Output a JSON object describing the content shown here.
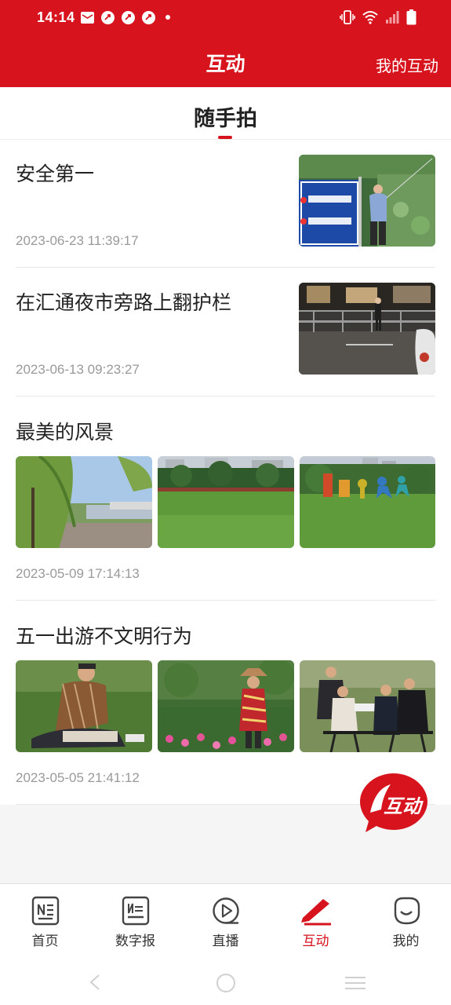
{
  "status_bar": {
    "time": "14:14",
    "icons": [
      "mail-icon",
      "app-notification-icon",
      "app-notification-icon",
      "app-notification-icon",
      "vibrate-icon",
      "wifi-icon",
      "signal-icon",
      "battery-icon"
    ]
  },
  "header": {
    "title": "互动",
    "right_link": "我的互动",
    "color": "#d7141e"
  },
  "tabs": [
    {
      "label": "随手拍",
      "active": true
    }
  ],
  "feed": [
    {
      "title": "安全第一",
      "time": "2023-06-23 11:39:17",
      "images": [
        "photo-fishing-sign"
      ]
    },
    {
      "title": "在汇通夜市旁路上翻护栏",
      "time": "2023-06-13 09:23:27",
      "images": [
        "photo-night-street-railing"
      ]
    },
    {
      "title": "最美的风景",
      "time": "2023-05-09 17:14:13",
      "images": [
        "photo-willows-river",
        "photo-lawn-park",
        "photo-lawn-sculpture"
      ]
    },
    {
      "title": "五一出游不文明行为",
      "time": "2023-05-05 21:41:12",
      "images": [
        "photo-man-on-grass",
        "photo-woman-in-flowers",
        "photo-group-on-grass"
      ]
    }
  ],
  "fab": {
    "label": "互动"
  },
  "bottom_nav": [
    {
      "label": "首页",
      "icon": "news-home-icon",
      "active": false
    },
    {
      "label": "数字报",
      "icon": "digital-paper-icon",
      "active": false
    },
    {
      "label": "直播",
      "icon": "live-play-icon",
      "active": false
    },
    {
      "label": "互动",
      "icon": "pen-interact-icon",
      "active": true
    },
    {
      "label": "我的",
      "icon": "smile-profile-icon",
      "active": false
    }
  ]
}
